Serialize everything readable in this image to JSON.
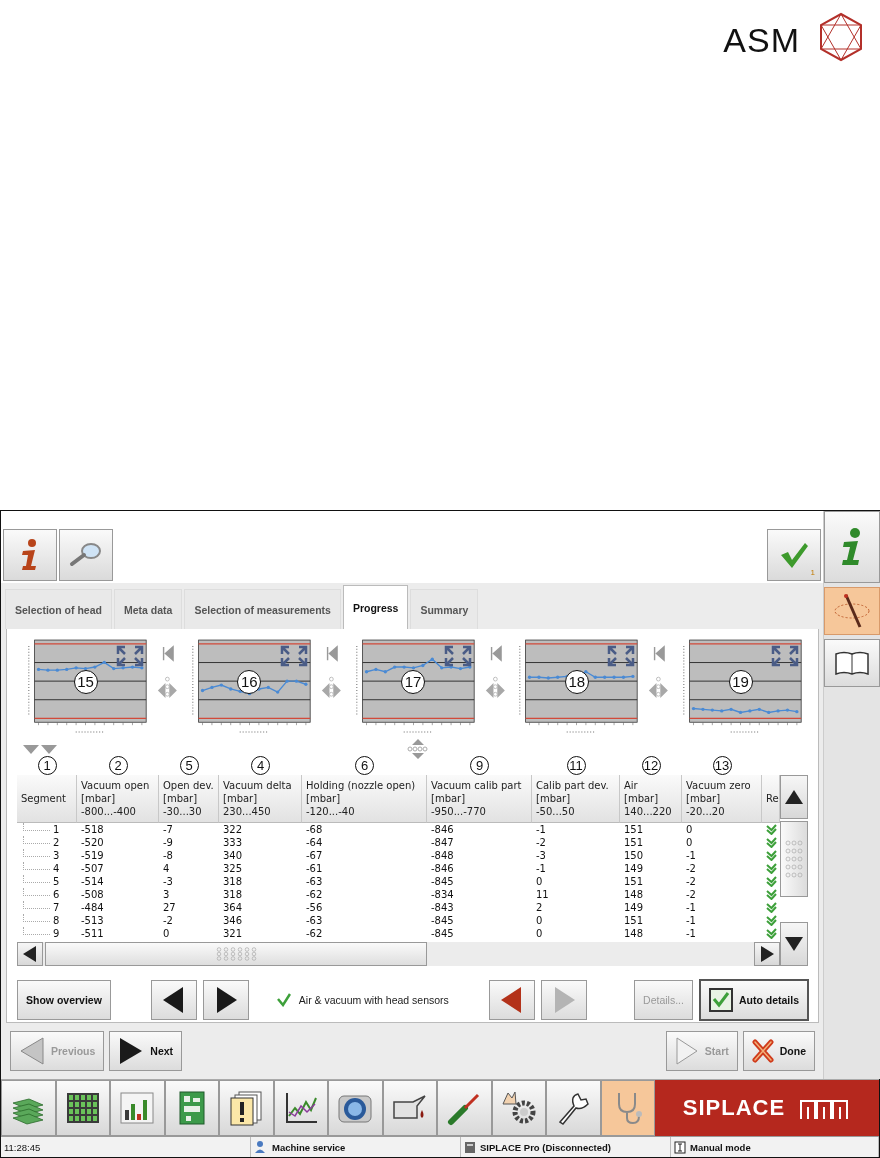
{
  "logo": {
    "text": "ASM"
  },
  "toolbar": {
    "check_badge": "1"
  },
  "sidebar": {
    "items": [
      {
        "kind": "info",
        "selected": false
      },
      {
        "kind": "tool",
        "selected": true
      },
      {
        "kind": "book",
        "selected": false
      }
    ]
  },
  "tabs": [
    {
      "label": "Selection of head",
      "selected": false
    },
    {
      "label": "Meta data",
      "selected": false
    },
    {
      "label": "Selection of measurements",
      "selected": false
    },
    {
      "label": "Progress",
      "selected": true
    },
    {
      "label": "Summary",
      "selected": false
    }
  ],
  "charts": [
    {
      "callout": "15"
    },
    {
      "callout": "16"
    },
    {
      "callout": "17"
    },
    {
      "callout": "18"
    },
    {
      "callout": "19"
    }
  ],
  "table": {
    "columns": [
      {
        "title": "Segment",
        "callout": "1"
      },
      {
        "title": "Vacuum open",
        "unit": "[mbar]",
        "range": "-800...-400",
        "callout": "2"
      },
      {
        "title": "Open dev.",
        "unit": "[mbar]",
        "range": "-30...30",
        "callout": "5"
      },
      {
        "title": "Vacuum delta",
        "unit": "[mbar]",
        "range": "230...450",
        "callout": "4"
      },
      {
        "title": "Holding (nozzle open)",
        "unit": "[mbar]",
        "range": "-120...-40",
        "callout": "6"
      },
      {
        "title": "Vacuum calib part",
        "unit": "[mbar]",
        "range": "-950...-770",
        "callout": "9"
      },
      {
        "title": "Calib part dev.",
        "unit": "[mbar]",
        "range": "-50...50",
        "callout": "11"
      },
      {
        "title": "Air",
        "unit": "[mbar]",
        "range": "140...220",
        "callout": "12"
      },
      {
        "title": "Vacuum zero",
        "unit": "[mbar]",
        "range": "-20...20",
        "callout": "13"
      },
      {
        "title": "Re"
      }
    ],
    "rows": [
      {
        "cells": [
          "1",
          "-518",
          "-7",
          "322",
          "-68",
          "-846",
          "-1",
          "151",
          "0"
        ],
        "ok": true
      },
      {
        "cells": [
          "2",
          "-520",
          "-9",
          "333",
          "-64",
          "-847",
          "-2",
          "151",
          "0"
        ],
        "ok": true
      },
      {
        "cells": [
          "3",
          "-519",
          "-8",
          "340",
          "-67",
          "-848",
          "-3",
          "150",
          "-1"
        ],
        "ok": true
      },
      {
        "cells": [
          "4",
          "-507",
          "4",
          "325",
          "-61",
          "-846",
          "-1",
          "149",
          "-2"
        ],
        "ok": true
      },
      {
        "cells": [
          "5",
          "-514",
          "-3",
          "318",
          "-63",
          "-845",
          "0",
          "151",
          "-2"
        ],
        "ok": true
      },
      {
        "cells": [
          "6",
          "-508",
          "3",
          "318",
          "-62",
          "-834",
          "11",
          "148",
          "-2"
        ],
        "ok": true
      },
      {
        "cells": [
          "7",
          "-484",
          "27",
          "364",
          "-56",
          "-843",
          "2",
          "149",
          "-1"
        ],
        "ok": true
      },
      {
        "cells": [
          "8",
          "-513",
          "-2",
          "346",
          "-63",
          "-845",
          "0",
          "151",
          "-1"
        ],
        "ok": true
      },
      {
        "cells": [
          "9",
          "-511",
          "0",
          "321",
          "-62",
          "-845",
          "0",
          "148",
          "-1"
        ],
        "ok": true
      }
    ]
  },
  "controls": {
    "show_overview": "Show overview",
    "segment_arrows": [
      {
        "kind": "left",
        "disabled": false,
        "highlighted": false
      },
      {
        "kind": "right",
        "disabled": false,
        "highlighted": false
      }
    ],
    "sensor_status": {
      "ok": true,
      "label": "Air & vacuum with head sensors"
    },
    "error_arrows": [
      {
        "kind": "left",
        "disabled": false,
        "highlighted": true
      },
      {
        "kind": "right",
        "disabled": true,
        "highlighted": false
      }
    ],
    "details": {
      "label": "Details...",
      "disabled": true
    },
    "auto_details": {
      "label": "Auto details",
      "checked": true
    }
  },
  "nav": {
    "previous": {
      "label": "Previous",
      "disabled": true
    },
    "next": {
      "label": "Next",
      "disabled": false
    },
    "start": {
      "label": "Start",
      "disabled": true
    },
    "done": {
      "label": "Done",
      "disabled": false
    }
  },
  "taskbar": {
    "items": [
      {
        "kind": "stack",
        "selected": false
      },
      {
        "kind": "grid",
        "selected": false
      },
      {
        "kind": "bars",
        "selected": false
      },
      {
        "kind": "board",
        "selected": false
      },
      {
        "kind": "docs",
        "selected": false
      },
      {
        "kind": "chart",
        "selected": false
      },
      {
        "kind": "camera",
        "selected": false
      },
      {
        "kind": "oil",
        "selected": false
      },
      {
        "kind": "screwdriver",
        "selected": false
      },
      {
        "kind": "gear",
        "selected": false
      },
      {
        "kind": "wrench",
        "selected": false
      },
      {
        "kind": "stethoscope",
        "selected": true
      }
    ],
    "brand": "SIPLACE"
  },
  "status_bar": {
    "time": "11:28:45",
    "user": "Machine service",
    "connection": "SIPLACE Pro (Disconnected)",
    "mode": "Manual mode"
  }
}
